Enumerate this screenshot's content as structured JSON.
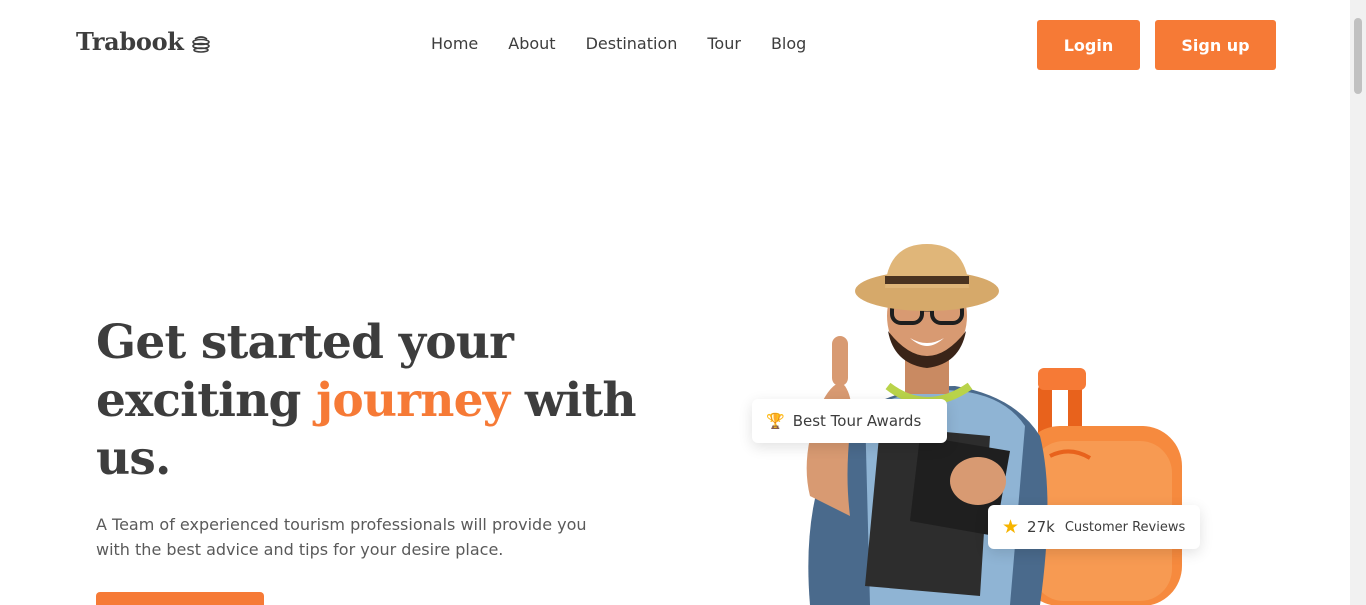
{
  "brand": {
    "name": "Trabook"
  },
  "nav": {
    "items": [
      "Home",
      "About",
      "Destination",
      "Tour",
      "Blog"
    ]
  },
  "auth": {
    "login_label": "Login",
    "signup_label": "Sign up"
  },
  "hero": {
    "title_part1": "Get started your exciting ",
    "title_accent": "journey",
    "title_part2": " with us.",
    "subtitle": "A Team of experienced tourism professionals will provide you with the best advice and tips for your desire place."
  },
  "badges": {
    "awards": {
      "icon": "trophy-icon",
      "label": "Best Tour Awards"
    },
    "reviews": {
      "icon": "star-icon",
      "count": "27k",
      "label": "Customer Reviews"
    }
  },
  "colors": {
    "accent": "#f67a36",
    "text": "#3d3d3d"
  }
}
